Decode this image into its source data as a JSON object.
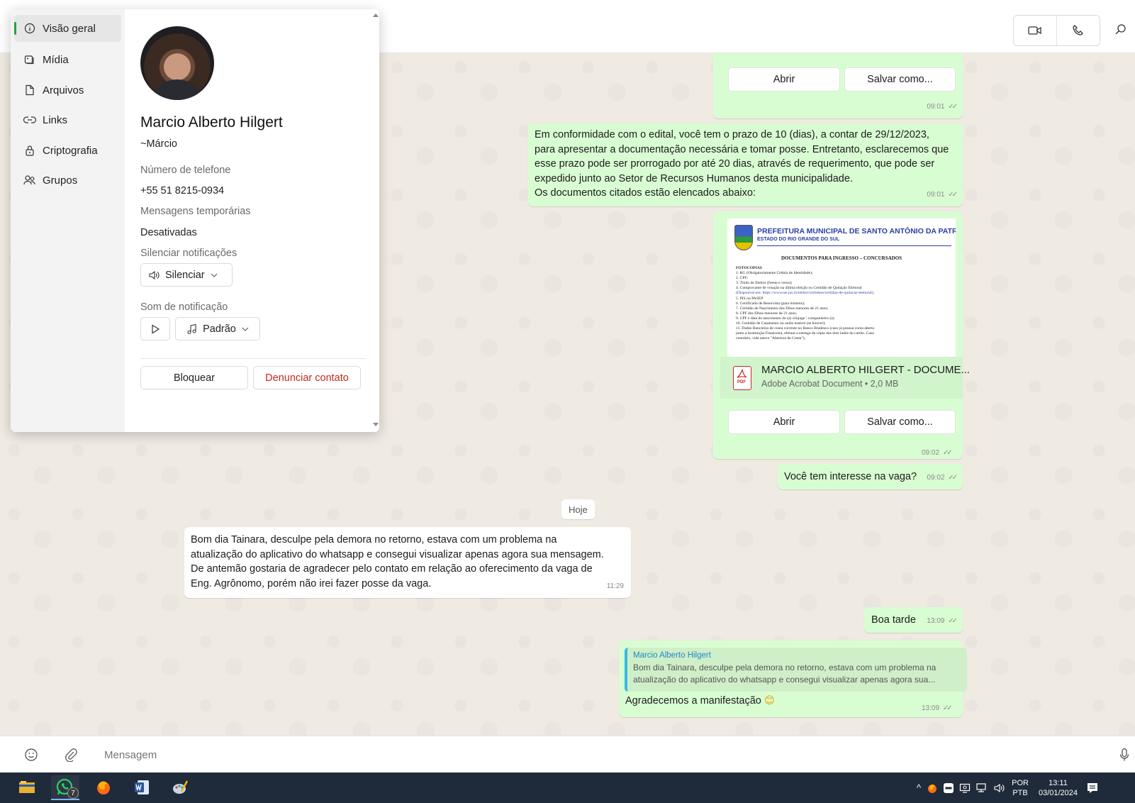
{
  "header": {
    "icons": [
      "video-call-icon",
      "voice-call-icon",
      "search-icon"
    ]
  },
  "contact_panel": {
    "nav": [
      {
        "label": "Visão geral",
        "icon": "info-icon"
      },
      {
        "label": "Mídia",
        "icon": "media-icon"
      },
      {
        "label": "Arquivos",
        "icon": "file-icon"
      },
      {
        "label": "Links",
        "icon": "link-icon"
      },
      {
        "label": "Criptografia",
        "icon": "lock-icon"
      },
      {
        "label": "Grupos",
        "icon": "groups-icon"
      }
    ],
    "name": "Marcio Alberto Hilgert",
    "alias": "~Márcio",
    "phone_label": "Número de telefone",
    "phone": "+55 51 8215-0934",
    "temp_messages_label": "Mensagens temporárias",
    "temp_messages_value": "Desativadas",
    "mute_label": "Silenciar notificações",
    "mute_button": "Silenciar",
    "sound_label": "Som de notificação",
    "sound_value": "Padrão",
    "block_button": "Bloquear",
    "report_button": "Denunciar contato"
  },
  "chat": {
    "msg1": {
      "open_label": "Abrir",
      "save_label": "Salvar como...",
      "time": "09:01"
    },
    "msg2": {
      "lines": [
        "Em conformidade com o edital, você tem o prazo de 10 (dias), a contar de 29/12/2023,",
        "para apresentar a documentação necessária e tomar posse. Entretanto, esclarecemos que",
        "esse prazo pode ser prorrogado por até 20 dias, através de requerimento, que pode ser",
        "expedido junto ao Setor de Recursos Humanos desta municipalidade.",
        "Os documentos citados estão elencados abaixo:"
      ],
      "time": "09:01"
    },
    "doc_msg": {
      "preview": {
        "heading": "PREFEITURA MUNICIPAL DE SANTO ANTÔNIO DA PATRULHA",
        "subheading": "ESTADO DO RIO GRANDE DO SUL",
        "title": "DOCUMENTOS PARA INGRESSO – CONCURSADOS",
        "lines": [
          "FOTOCÓPIAS",
          "1.     RG (Obrigatoriamente Cédula de Identidade);",
          "2.     CPF;",
          "3.     Título de Eleitor (frente e verso);",
          "4.     Comprovante de votação na última eleição ou Certidão de Quitação Eleitoral",
          "(Disponível em: https://www.tse.jus.br/eleitor/certidoes/certidao-de-quitacao-eleitoral);",
          "5.     PIS ou PASEP",
          "6.     Certificado de Reservista (para homens);",
          "7.     Certidão de Nascimento dos filhos menores de 21 anos;",
          "8.     CPF dos filhos menores de 21 anos;",
          "9.     CPF e data de nascimento do (a) cônjuge / companheiro (a)",
          "10.   Certidão de Casamento ou união estável (se houver);",
          "11.   Dados Bancários de conta corrente no Banco Bradesco (caso já possua conta aberta",
          "junto a Instituição Financeira, efetuar a entrega da cópia dos dois lados do cartão. Caso",
          "contrário, vide anexo \"Abertura de Conta\");"
        ]
      },
      "file_name": "MARCIO ALBERTO HILGERT - DOCUME...",
      "file_meta": "Adobe Acrobat Document • 2,0 MB",
      "pdf_badge": "PDF",
      "open_label": "Abrir",
      "save_label": "Salvar como...",
      "time": "09:02"
    },
    "msg4": {
      "text": "Você tem interesse na vaga?",
      "time": "09:02"
    },
    "day_separator": "Hoje",
    "incoming": {
      "lines": [
        "Bom dia Tainara, desculpe pela demora no retorno, estava com um problema na",
        "atualização do aplicativo do whatsapp e consegui visualizar apenas agora sua mensagem.",
        "De antemão gostaria de agradecer pelo contato em relação ao oferecimento da vaga de",
        "Eng. Agrônomo, porém não irei fazer posse da vaga."
      ],
      "time": "11:29"
    },
    "msg6": {
      "text": "Boa tarde",
      "time": "13:09"
    },
    "msg7": {
      "quote_name": "Marcio Alberto Hilgert",
      "quote_lines": [
        "Bom dia Tainara, desculpe pela demora no retorno, estava com um problema na",
        "atualização do aplicativo do whatsapp e consegui visualizar apenas agora sua..."
      ],
      "text": "Agradecemos a manifestação",
      "emoji": "😊",
      "time": "13:09"
    },
    "tick": "✓✓"
  },
  "compose": {
    "placeholder": "Mensagem",
    "icons": [
      "emoji-icon",
      "attach-icon",
      "microphone-icon"
    ]
  },
  "taskbar": {
    "apps": [
      "file-explorer-icon",
      "whatsapp-icon",
      "firefox-icon",
      "word-icon",
      "paint-icon"
    ],
    "whatsapp_badge": "7",
    "lang_top": "POR",
    "lang_bottom": "PTB",
    "time": "13:11",
    "date": "03/01/2024"
  }
}
